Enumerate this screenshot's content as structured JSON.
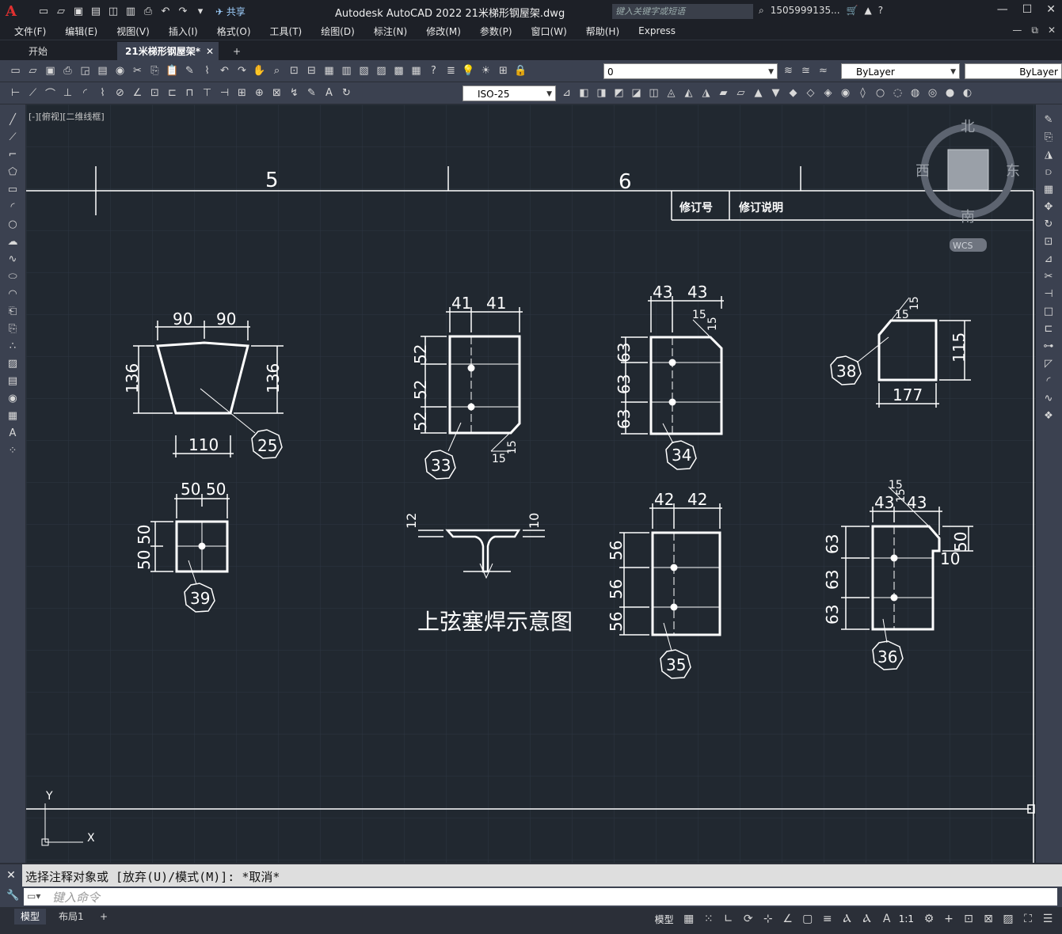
{
  "app": {
    "title": "Autodesk AutoCAD 2022    21米梯形钢屋架.dwg",
    "logo": "A",
    "share": "共享",
    "search_placeholder": "键入关键字或短语",
    "user": "1505999135...",
    "accent": "#e03030"
  },
  "menu": [
    "文件(F)",
    "编辑(E)",
    "视图(V)",
    "插入(I)",
    "格式(O)",
    "工具(T)",
    "绘图(D)",
    "标注(N)",
    "修改(M)",
    "参数(P)",
    "窗口(W)",
    "帮助(H)",
    "Express"
  ],
  "tabs": [
    {
      "label": "开始"
    },
    {
      "label": "21米梯形钢屋架*",
      "active": true
    }
  ],
  "toolbar": {
    "layer_value": "0",
    "color_value": "ByLayer",
    "linetype_value": "ByLayer",
    "dimstyle_value": "ISO-25"
  },
  "viewport_label": "[-][俯视][二维线框]",
  "viewcube": {
    "north": "北",
    "south": "南",
    "east": "东",
    "west": "西",
    "coord": "WCS"
  },
  "drawing": {
    "axis_numbers": [
      "5",
      "6"
    ],
    "revision_headers": [
      "修订号",
      "修订说明"
    ],
    "title_weld": "上弦塞焊示意图",
    "parts": [
      {
        "id": "25",
        "dims": [
          "90",
          "90",
          "136",
          "136",
          "110"
        ]
      },
      {
        "id": "33",
        "dims": [
          "41",
          "41",
          "52",
          "52",
          "52",
          "15",
          "15"
        ]
      },
      {
        "id": "34",
        "dims": [
          "43",
          "43",
          "63",
          "63",
          "63",
          "15",
          "15"
        ]
      },
      {
        "id": "38",
        "dims": [
          "15",
          "15",
          "115",
          "177"
        ]
      },
      {
        "id": "39",
        "dims": [
          "50",
          "50",
          "50",
          "50"
        ]
      },
      {
        "id": "35",
        "dims": [
          "42",
          "42",
          "56",
          "56",
          "56"
        ]
      },
      {
        "id": "36",
        "dims": [
          "15",
          "15",
          "43",
          "43",
          "63",
          "63",
          "63",
          "50",
          "10"
        ]
      }
    ],
    "weld_dims": [
      "12",
      "10"
    ],
    "ucs_x": "X",
    "ucs_y": "Y"
  },
  "command": {
    "history": "选择注释对象或 [放弃(U)/模式(M)]: *取消*",
    "placeholder": "键入命令"
  },
  "status": {
    "layout_tabs": [
      {
        "label": "模型",
        "active": true
      },
      {
        "label": "布局1"
      }
    ],
    "model_label": "模型",
    "scale": "1:1"
  }
}
